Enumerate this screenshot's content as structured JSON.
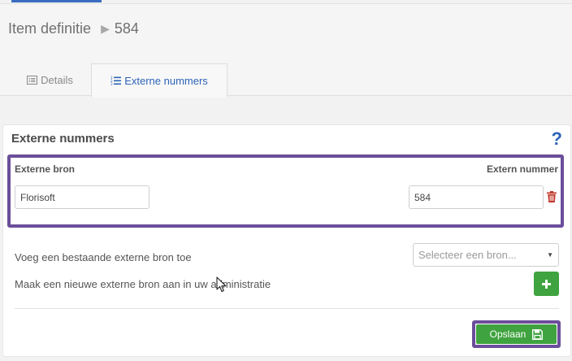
{
  "breadcrumb": {
    "root": "Item definitie",
    "current": "584"
  },
  "tabs": [
    {
      "label": "Details",
      "icon": "list-alt-icon"
    },
    {
      "label": "Externe nummers",
      "icon": "list-ol-icon",
      "active": true
    }
  ],
  "panel": {
    "title": "Externe nummers",
    "help": "?",
    "columns": {
      "source": "Externe bron",
      "number": "Extern nummer"
    },
    "rows": [
      {
        "source": "Florisoft",
        "number": "584"
      }
    ],
    "add_existing_label": "Voeg een bestaande externe bron toe",
    "select_placeholder": "Selecteer een bron...",
    "create_new_label": "Maak een nieuwe externe bron aan in uw administratie",
    "save_label": "Opslaan"
  },
  "colors": {
    "accent_blue": "#2d63b6",
    "green": "#3fa33f",
    "highlight": "#6b4e9b",
    "danger": "#c0392b"
  }
}
